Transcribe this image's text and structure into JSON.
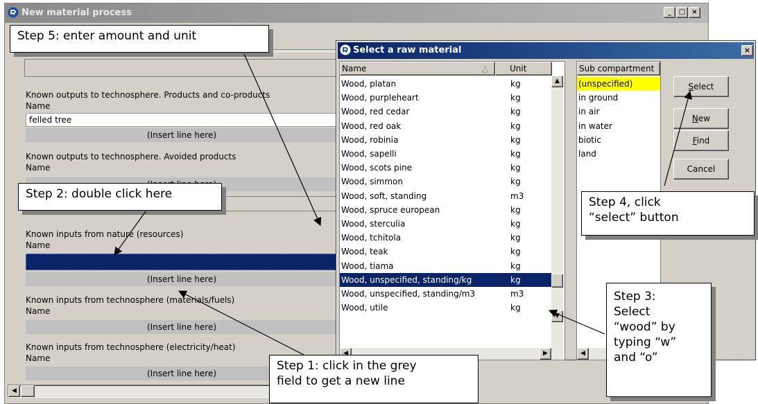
{
  "main_window": {
    "title": "New material process",
    "minimize": "_",
    "maximize": "□",
    "close": "×",
    "sections": {
      "products_label": "Known outputs to technosphere. Products and co-products",
      "products_name": "Name",
      "products_value": "felled tree",
      "products_insert": "(Insert line here)",
      "avoided_label": "Known outputs to technosphere. Avoided products",
      "avoided_name": "Name",
      "avoided_insert": "(Insert line here)",
      "nature_label": "Known inputs from nature (resources)",
      "nature_name": "Name",
      "nature_insert": "(Insert line here)",
      "materials_label": "Known inputs from technosphere (materials/fuels)",
      "materials_name": "Name",
      "materials_insert": "(Insert line here)",
      "electricity_label": "Known inputs from technosphere (electricity/heat)",
      "electricity_name": "Name",
      "electricity_insert": "(Insert line here)"
    }
  },
  "dialog": {
    "title": "Select a raw material",
    "close": "×",
    "columns": {
      "name": "Name",
      "unit": "Unit",
      "sub": "Sub compartment"
    },
    "rows": [
      {
        "name": "Wood, platan",
        "unit": "kg"
      },
      {
        "name": "Wood, purpleheart",
        "unit": "kg"
      },
      {
        "name": "Wood, red cedar",
        "unit": "kg"
      },
      {
        "name": "Wood, red oak",
        "unit": "kg"
      },
      {
        "name": "Wood, robinia",
        "unit": "kg"
      },
      {
        "name": "Wood, sapelli",
        "unit": "kg"
      },
      {
        "name": "Wood, scots pine",
        "unit": "kg"
      },
      {
        "name": "Wood, simmon",
        "unit": "kg"
      },
      {
        "name": "Wood, soft, standing",
        "unit": "m3"
      },
      {
        "name": "Wood, spruce european",
        "unit": "kg"
      },
      {
        "name": "Wood, sterculia",
        "unit": "kg"
      },
      {
        "name": "Wood, tchitola",
        "unit": "kg"
      },
      {
        "name": "Wood, teak",
        "unit": "kg"
      },
      {
        "name": "Wood, tiama",
        "unit": "kg"
      },
      {
        "name": "Wood, unspecified, standing/kg",
        "unit": "kg"
      },
      {
        "name": "Wood, unspecified, standing/m3",
        "unit": "m3"
      },
      {
        "name": "Wood, utile",
        "unit": "kg"
      }
    ],
    "selected_row": "Wood, unspecified, standing/kg",
    "sub_compartments": [
      "(unspecified)",
      "in ground",
      "in air",
      "in water",
      "biotic",
      "land"
    ],
    "selected_sub": "(unspecified)",
    "buttons": {
      "select": "Select",
      "select_key": "S",
      "select_rest": "elect",
      "new": "New",
      "new_key": "N",
      "new_rest": "ew",
      "find": "Find",
      "find_key": "F",
      "find_rest": "ind",
      "cancel": "Cancel"
    }
  },
  "callouts": {
    "step5": "Step 5: enter amount and unit",
    "step2": "Step 2: double click here",
    "step4_line1": "Step 4, click",
    "step4_line2": "“select” button",
    "step3_line1": "Step 3:",
    "step3_line2": "Select",
    "step3_line3": "“wood” by",
    "step3_line4": "typing “w”",
    "step3_line5": "and “o”",
    "step1_line1": "Step 1: click in the grey",
    "step1_line2": "field to get a new line"
  },
  "colors": {
    "selection": "#0a246a",
    "highlight_yellow": "#ffff00",
    "face": "#d4d0c8",
    "insert_grey": "#c0c0c0"
  }
}
